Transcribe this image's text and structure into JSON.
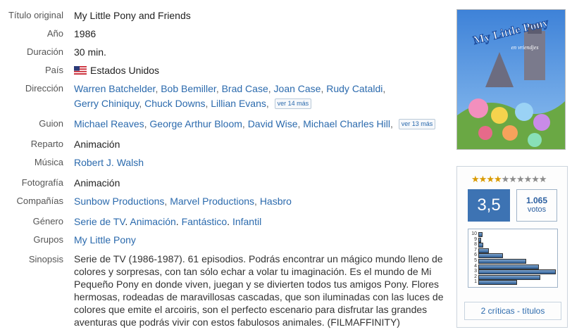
{
  "labels": {
    "titulo": "Título original",
    "anio": "Año",
    "duracion": "Duración",
    "pais": "País",
    "direccion": "Dirección",
    "guion": "Guion",
    "reparto": "Reparto",
    "musica": "Música",
    "fotografia": "Fotografía",
    "companias": "Compañías",
    "genero": "Género",
    "grupos": "Grupos",
    "sinopsis": "Sinopsis"
  },
  "film": {
    "titulo": "My Little Pony and Friends",
    "anio": "1986",
    "duracion": "30 min.",
    "pais": "Estados Unidos",
    "direccion": [
      "Warren Batchelder",
      "Bob Bemiller",
      "Brad Case",
      "Joan Case",
      "Rudy Cataldi",
      "Gerry Chiniquy",
      "Chuck Downs",
      "Lillian Evans"
    ],
    "direccion_more": "ver 14 más",
    "guion": [
      "Michael Reaves",
      "George Arthur Bloom",
      "David Wise",
      "Michael Charles Hill"
    ],
    "guion_more": "ver 13 más",
    "reparto": "Animación",
    "musica": "Robert J. Walsh",
    "fotografia": "Animación",
    "companias": [
      "Sunbow Productions",
      "Marvel Productions",
      "Hasbro"
    ],
    "genero": [
      "Serie de TV",
      "Animación",
      "Fantástico",
      "Infantil"
    ],
    "grupos": "My Little Pony",
    "sinopsis": "Serie de TV (1986-1987). 61 episodios. Podrás encontrar un mágico mundo lleno de colores y sorpresas, con tan sólo echar a volar tu imaginación. Es el mundo de Mi Pequeño Pony en donde viven, juegan y se divierten todos tus amigos Pony. Flores hermosas, rodeadas de maravillosas cascadas, que son iluminadas con las luces de colores que emite el arcoiris, son el perfecto escenario para disfrutar las grandes aventuras que podrás vivir con estos fabulosos animales. (FILMAFFINITY)"
  },
  "poster": {
    "line1": "My Little Pony",
    "line2": "en vriendjes"
  },
  "rating": {
    "score": "3,5",
    "stars_filled": 4,
    "stars_total": 10,
    "votes_count": "1.065",
    "votes_label": "votos",
    "histogram": [
      {
        "label": "10",
        "value": 0.05
      },
      {
        "label": "9",
        "value": 0.04
      },
      {
        "label": "8",
        "value": 0.06
      },
      {
        "label": "7",
        "value": 0.14
      },
      {
        "label": "6",
        "value": 0.32
      },
      {
        "label": "5",
        "value": 0.62
      },
      {
        "label": "4",
        "value": 0.78
      },
      {
        "label": "3",
        "value": 1.0
      },
      {
        "label": "2",
        "value": 0.8
      },
      {
        "label": "1",
        "value": 0.5
      }
    ],
    "critics_link": "2 críticas - títulos"
  },
  "colors": {
    "link": "#2b6aad",
    "score_bg": "#3d73b3",
    "star_on": "#d99a00",
    "star_off": "#8c8c8c"
  }
}
